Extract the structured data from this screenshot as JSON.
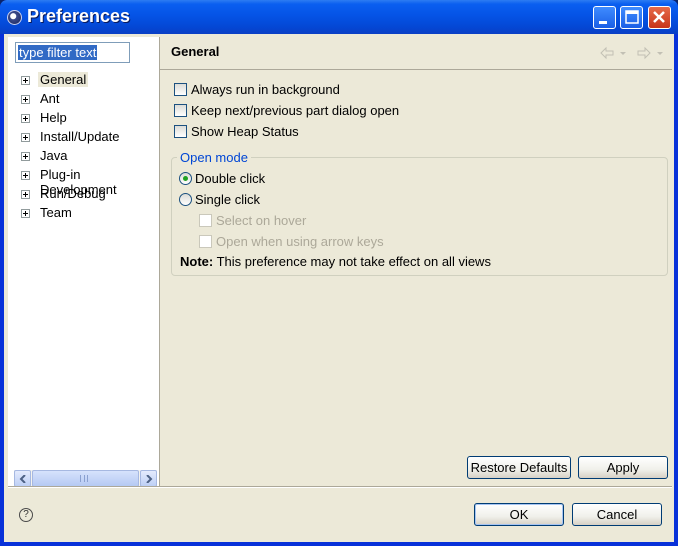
{
  "window": {
    "title": "Preferences"
  },
  "titlebar_buttons": [
    "minimize",
    "maximize",
    "close"
  ],
  "filter": {
    "value": "type filter text"
  },
  "tree": {
    "items": [
      {
        "label": "General",
        "selected": true
      },
      {
        "label": "Ant"
      },
      {
        "label": "Help"
      },
      {
        "label": "Install/Update"
      },
      {
        "label": "Java"
      },
      {
        "label": "Plug-in Development"
      },
      {
        "label": "Run/Debug"
      },
      {
        "label": "Team"
      }
    ]
  },
  "page": {
    "title": "General",
    "options": [
      {
        "label": "Always run in background",
        "checked": false
      },
      {
        "label": "Keep next/previous part dialog open",
        "checked": false
      },
      {
        "label": "Show Heap Status",
        "checked": false
      }
    ],
    "open_mode": {
      "title": "Open mode",
      "double_click": "Double click",
      "single_click": "Single click",
      "select_on_hover": "Select on hover",
      "open_arrow_keys": "Open when using arrow keys",
      "selected": "Double click"
    },
    "note_label": "Note:",
    "note_text": "This preference may not take effect on all views"
  },
  "buttons": {
    "restore_defaults": "Restore Defaults",
    "apply": "Apply",
    "ok": "OK",
    "cancel": "Cancel",
    "help": "?"
  },
  "colors": {
    "titlebar": "#0a5ff0",
    "dialog_bg": "#ece9d8",
    "group_title": "#0046d5"
  }
}
